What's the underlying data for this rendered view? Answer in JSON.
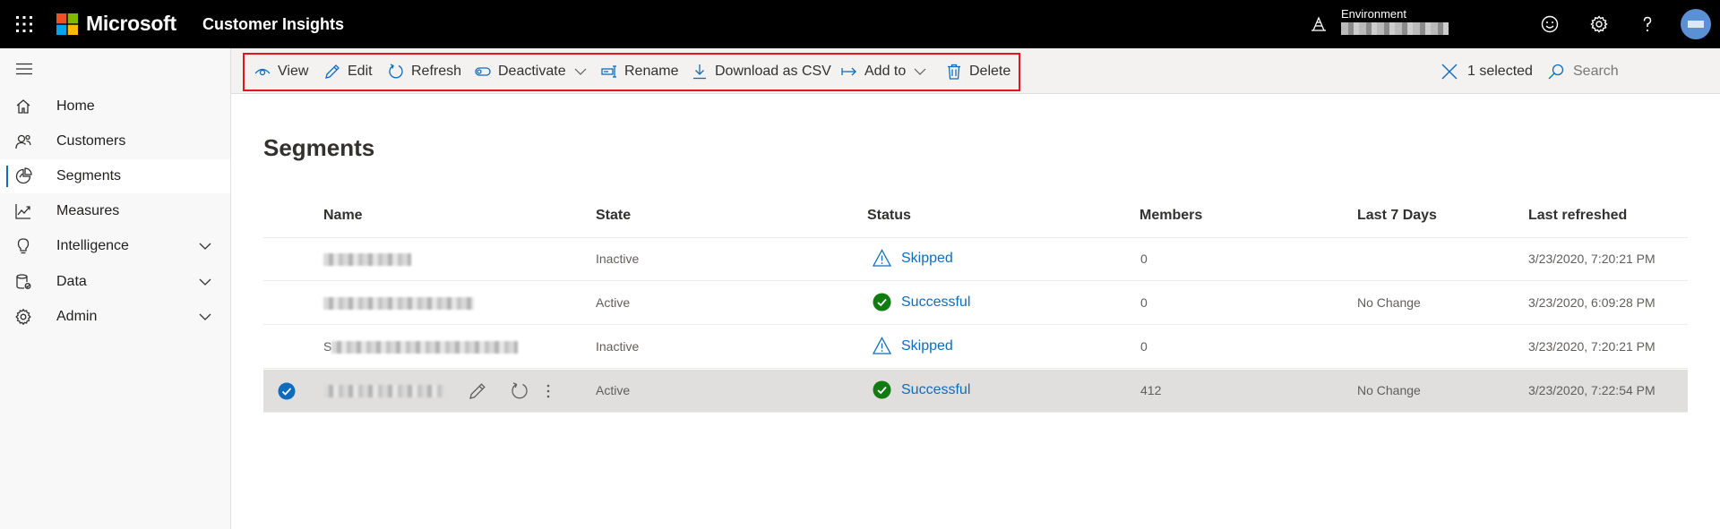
{
  "topbar": {
    "brand": "Microsoft",
    "app_title": "Customer Insights",
    "environment_label": "Environment"
  },
  "sidebar": {
    "items": [
      {
        "label": "Home",
        "icon": "home-icon"
      },
      {
        "label": "Customers",
        "icon": "customers-icon"
      },
      {
        "label": "Segments",
        "icon": "segments-icon",
        "selected": true
      },
      {
        "label": "Measures",
        "icon": "measures-icon"
      },
      {
        "label": "Intelligence",
        "icon": "lightbulb-icon",
        "expandable": true
      },
      {
        "label": "Data",
        "icon": "database-icon",
        "expandable": true
      },
      {
        "label": "Admin",
        "icon": "gear-icon",
        "expandable": true
      }
    ]
  },
  "commandbar": {
    "view": "View",
    "edit": "Edit",
    "refresh": "Refresh",
    "deactivate": "Deactivate",
    "rename": "Rename",
    "download": "Download as CSV",
    "add_to": "Add to",
    "delete": "Delete",
    "selected_count": "1 selected",
    "search_placeholder": "Search"
  },
  "page": {
    "title": "Segments"
  },
  "table": {
    "columns": [
      "Name",
      "State",
      "Status",
      "Members",
      "Last 7 Days",
      "Last refreshed"
    ],
    "rows": [
      {
        "name_prefix": "",
        "state": "Inactive",
        "status": "Skipped",
        "members": "0",
        "last7": "",
        "refreshed": "3/23/2020, 7:20:21 PM",
        "selected": false
      },
      {
        "name_prefix": "",
        "state": "Active",
        "status": "Successful",
        "members": "0",
        "last7": "No Change",
        "refreshed": "3/23/2020, 6:09:28 PM",
        "selected": false
      },
      {
        "name_prefix": "S",
        "state": "Inactive",
        "status": "Skipped",
        "members": "0",
        "last7": "",
        "refreshed": "3/23/2020, 7:20:21 PM",
        "selected": false
      },
      {
        "name_prefix": "",
        "state": "Active",
        "status": "Successful",
        "members": "412",
        "last7": "No Change",
        "refreshed": "3/23/2020, 7:22:54 PM",
        "selected": true
      }
    ]
  },
  "colors": {
    "topbar_bg": "#000000",
    "accent": "#0f6cbd",
    "success": "#107c10",
    "highlight_border": "#e3151a",
    "selected_row": "#e1dfdd"
  }
}
